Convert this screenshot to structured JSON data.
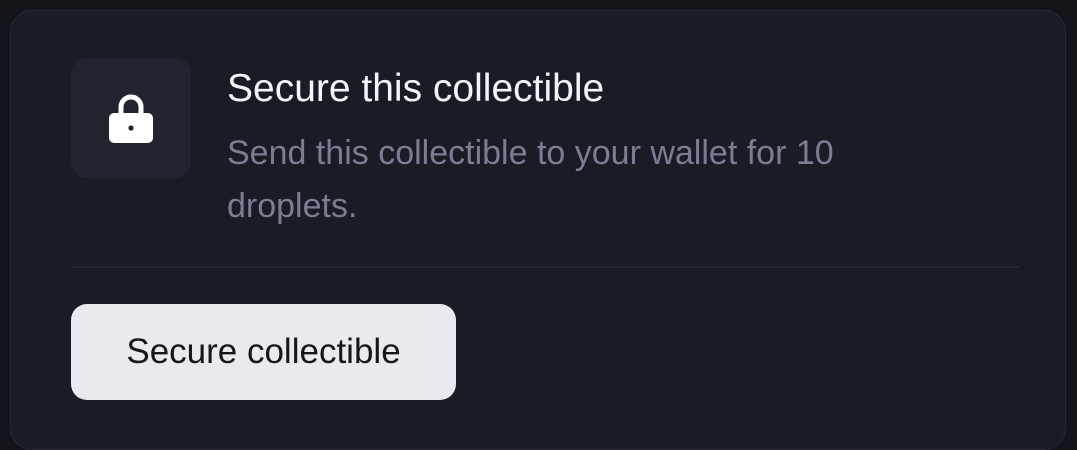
{
  "panel": {
    "icon": "lock-icon",
    "title": "Secure this collectible",
    "description": "Send this collectible to your wallet for 10 droplets.",
    "button_label": "Secure collectible"
  },
  "colors": {
    "background": "#121419",
    "card": "#191c24",
    "icon_tile": "#21242f",
    "title_text": "#f4f5f8",
    "description_text": "#7a7e93",
    "button_background": "#e9eaef",
    "button_text": "#15171d"
  }
}
